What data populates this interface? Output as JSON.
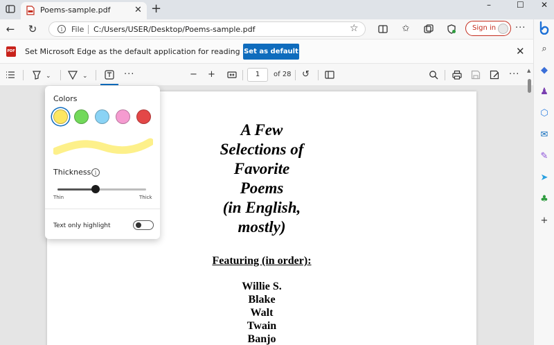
{
  "tab": {
    "title": "Poems-sample.pdf"
  },
  "window_controls": {
    "minimize": "–",
    "maximize": "☐",
    "close": "✕"
  },
  "address_bar": {
    "file_label": "File",
    "url": "C:/Users/USER/Desktop/Poems-sample.pdf",
    "sign_in_label": "Sign in"
  },
  "notification": {
    "message": "Set Microsoft Edge as the default application for reading PDF files?",
    "button_label": "Set as default",
    "badge_text": "PDF"
  },
  "pdf_toolbar": {
    "current_page": "1",
    "page_total_label": "of 28"
  },
  "highlight_popup": {
    "colors_label": "Colors",
    "colors": [
      {
        "name": "yellow",
        "hex": "#fde761"
      },
      {
        "name": "green",
        "hex": "#72d95a"
      },
      {
        "name": "light-blue",
        "hex": "#8ad3f5"
      },
      {
        "name": "pink",
        "hex": "#f59bd0"
      },
      {
        "name": "red",
        "hex": "#e34747"
      }
    ],
    "selected_color": "yellow",
    "preview_color": "#fdf08a",
    "thickness_label": "Thickness",
    "thickness_value": 0.43,
    "thin_label": "Thin",
    "thick_label": "Thick",
    "text_only_highlight_label": "Text only highlight",
    "text_only_highlight_on": false
  },
  "document": {
    "title_lines": [
      "A Few",
      "Selections of",
      "Favorite",
      "Poems",
      "(in English,",
      "mostly)"
    ],
    "featuring_label": "Featuring (in order):",
    "authors": [
      "Willie S.",
      "Blake",
      "Walt",
      "Twain",
      "Banjo"
    ]
  },
  "sidebar_icons": [
    {
      "name": "search-icon",
      "color": "#333333"
    },
    {
      "name": "tag-icon",
      "color": "#3b6fd8"
    },
    {
      "name": "games-icon",
      "color": "#7a3fb0"
    },
    {
      "name": "m365-icon",
      "color": "#2f7fe0"
    },
    {
      "name": "outlook-icon",
      "color": "#0f6cbd"
    },
    {
      "name": "designer-icon",
      "color": "#8b4fd8"
    },
    {
      "name": "send-icon",
      "color": "#2aa0e0"
    },
    {
      "name": "tree-icon",
      "color": "#2e9b3e"
    },
    {
      "name": "add-icon",
      "color": "#333333"
    }
  ]
}
